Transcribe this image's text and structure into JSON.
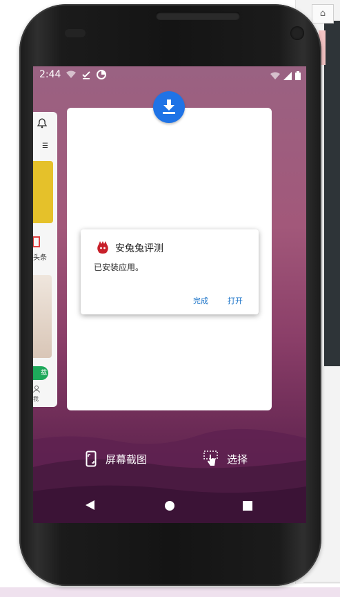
{
  "status_bar": {
    "time": "2:44"
  },
  "notification": {
    "app_name": "安兔兔评测",
    "message": "已安装应用。",
    "done_label": "完成",
    "open_label": "打开"
  },
  "recents_actions": {
    "screenshot_label": "屏幕截图",
    "select_label": "选择"
  },
  "side_card": {
    "visible_text": "头条",
    "button_text": "载",
    "small_text": "我"
  },
  "colors": {
    "accent_blue": "#1a73c8",
    "download_badge": "#1f73e6",
    "wallpaper_top": "#9a6282",
    "wallpaper_bottom": "#4a1d42"
  },
  "icons": [
    "wifi-icon",
    "check-icon",
    "data-saver-icon",
    "signal-icon",
    "battery-icon",
    "download-icon",
    "antutu-icon",
    "screenshot-icon",
    "select-icon",
    "back-icon",
    "home-icon",
    "recents-icon",
    "bell-icon"
  ]
}
